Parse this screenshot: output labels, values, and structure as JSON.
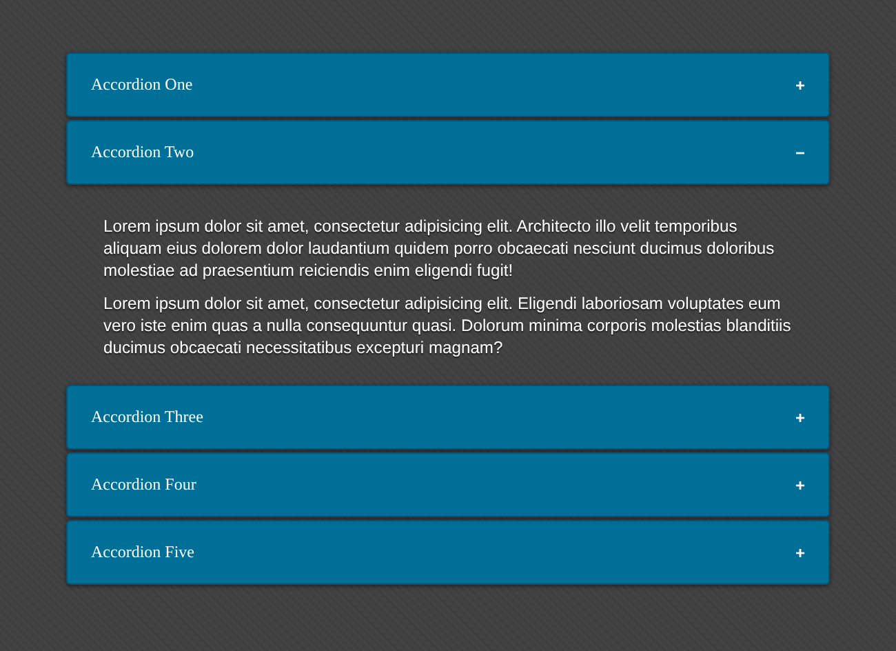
{
  "accordion": [
    {
      "title": "Accordion One",
      "sign": "+"
    },
    {
      "title": "Accordion Two",
      "sign": "−",
      "paragraphs": [
        "Lorem ipsum dolor sit amet, consectetur adipisicing elit. Architecto illo velit temporibus aliquam eius dolorem dolor laudantium quidem porro obcaecati nesciunt ducimus doloribus molestiae ad praesentium reiciendis enim eligendi fugit!",
        "Lorem ipsum dolor sit amet, consectetur adipisicing elit. Eligendi laboriosam voluptates eum vero iste enim quas a nulla consequuntur quasi. Dolorum minima corporis molestias blanditiis ducimus obcaecati necessitatibus excepturi magnam?"
      ]
    },
    {
      "title": "Accordion Three",
      "sign": "+"
    },
    {
      "title": "Accordion Four",
      "sign": "+"
    },
    {
      "title": "Accordion Five",
      "sign": "+"
    }
  ]
}
